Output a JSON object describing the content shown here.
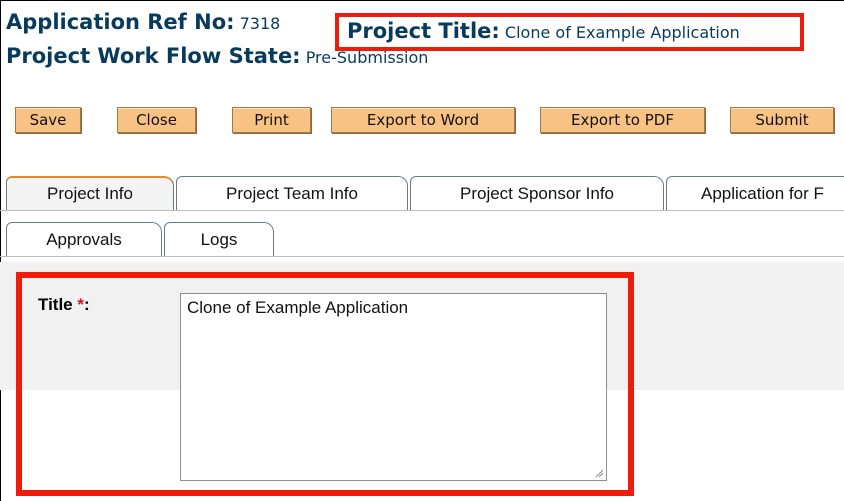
{
  "header": {
    "app_ref_label": "Application Ref No:",
    "app_ref_value": "7318",
    "project_title_label": "Project Title:",
    "project_title_value": "Clone of Example Application",
    "workflow_label": "Project Work Flow State:",
    "workflow_value": "Pre-Submission"
  },
  "toolbar": {
    "buttons": [
      "Save",
      "Close",
      "Print",
      "Export to Word",
      "Export to PDF",
      "Submit"
    ]
  },
  "tabs": {
    "row1": [
      "Project Info",
      "Project Team Info",
      "Project Sponsor Info",
      "Application for F"
    ],
    "row2": [
      "Approvals",
      "Logs"
    ],
    "active": "Project Info"
  },
  "form": {
    "title_label": "Title",
    "required_marker": "*",
    "label_suffix": ":",
    "title_value": "Clone of Example Application"
  },
  "colors": {
    "header_text": "#083a5e",
    "button_bg": "#f7c284",
    "highlight_box": "#ee1c0b",
    "required": "#e0101a"
  }
}
